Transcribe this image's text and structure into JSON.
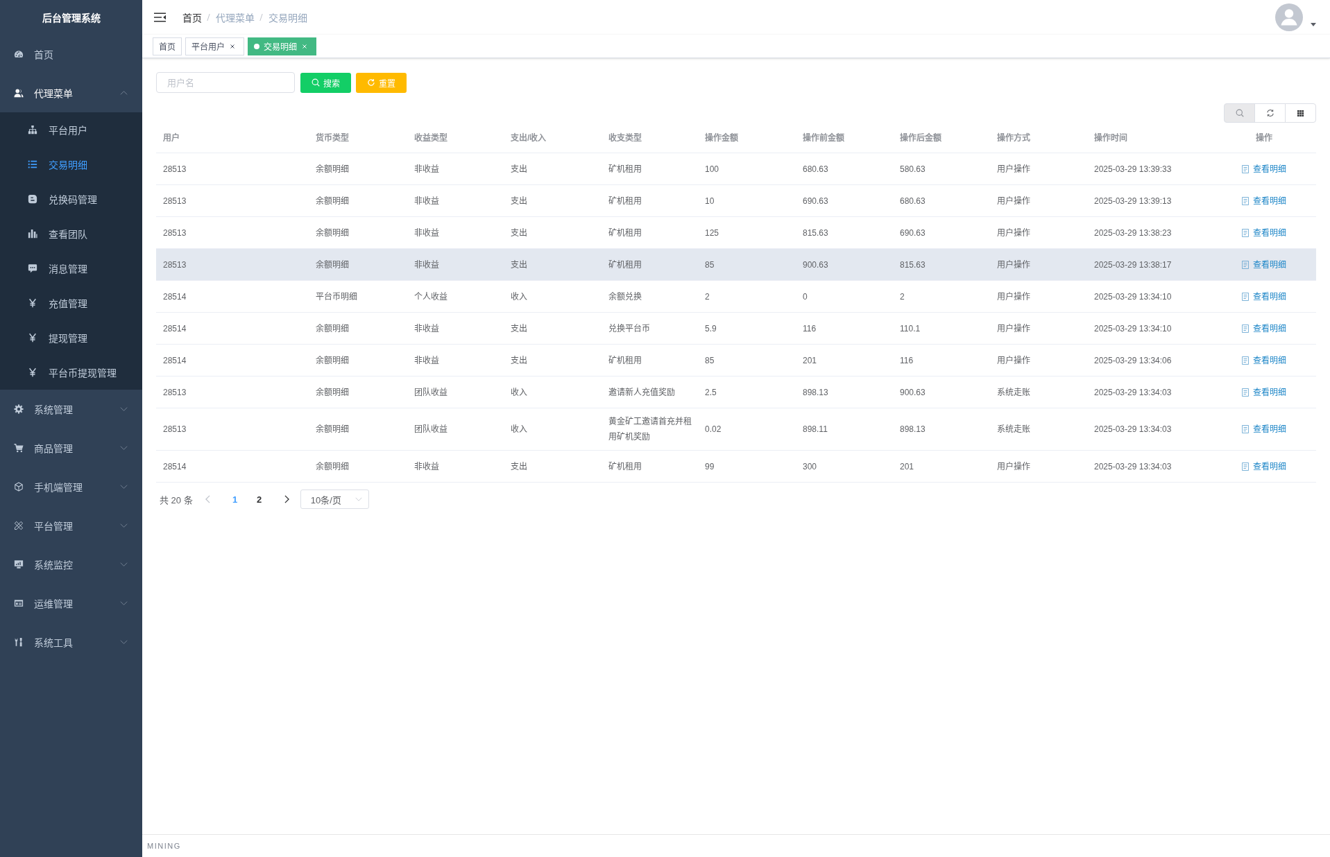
{
  "sidebar": {
    "title": "后台管理系统",
    "items": [
      {
        "kind": "link",
        "label": "首页",
        "selected": false
      },
      {
        "kind": "submenu",
        "label": "代理菜单",
        "expanded": true,
        "children": [
          {
            "label": "平台用户",
            "selected": false
          },
          {
            "label": "交易明细",
            "selected": true
          },
          {
            "label": "兑换码管理",
            "selected": false
          },
          {
            "label": "查看团队",
            "selected": false
          },
          {
            "label": "消息管理",
            "selected": false
          },
          {
            "label": "充值管理",
            "selected": false
          },
          {
            "label": "提现管理",
            "selected": false
          },
          {
            "label": "平台币提现管理",
            "selected": false
          }
        ]
      },
      {
        "kind": "submenu",
        "label": "系统管理",
        "expanded": false
      },
      {
        "kind": "submenu",
        "label": "商品管理",
        "expanded": false
      },
      {
        "kind": "submenu",
        "label": "手机端管理",
        "expanded": false
      },
      {
        "kind": "submenu",
        "label": "平台管理",
        "expanded": false
      },
      {
        "kind": "submenu",
        "label": "系统监控",
        "expanded": false
      },
      {
        "kind": "submenu",
        "label": "运维管理",
        "expanded": false
      },
      {
        "kind": "submenu",
        "label": "系统工具",
        "expanded": false
      }
    ]
  },
  "breadcrumb": [
    {
      "label": "首页",
      "link": true
    },
    {
      "label": "代理菜单",
      "link": false
    },
    {
      "label": "交易明细",
      "link": false
    }
  ],
  "tags": [
    {
      "label": "首页",
      "selected": false,
      "closable": false
    },
    {
      "label": "平台用户",
      "selected": false,
      "closable": true
    },
    {
      "label": "交易明细",
      "selected": true,
      "closable": true
    }
  ],
  "search": {
    "placeholder": "用户名",
    "buttons": [
      {
        "kind": "success",
        "label": "搜索"
      },
      {
        "kind": "warning",
        "label": "重置"
      }
    ]
  },
  "toolbar": [
    {
      "selected": true
    },
    {
      "selected": false
    },
    {
      "selected": false
    }
  ],
  "table": {
    "columns": [
      "用户",
      "货币类型",
      "收益类型",
      "支出/收入",
      "收支类型",
      "操作金额",
      "操作前金额",
      "操作后金额",
      "操作方式",
      "操作时间",
      "操作"
    ],
    "rows": [
      {
        "cells": [
          "28513",
          "余额明细",
          "非收益",
          "支出",
          "矿机租用",
          "100",
          "680.63",
          "580.63",
          "用户操作",
          "2025-03-29 13:39:33"
        ],
        "action": "查看明细",
        "highlighted": false
      },
      {
        "cells": [
          "28513",
          "余额明细",
          "非收益",
          "支出",
          "矿机租用",
          "10",
          "690.63",
          "680.63",
          "用户操作",
          "2025-03-29 13:39:13"
        ],
        "action": "查看明细",
        "highlighted": false
      },
      {
        "cells": [
          "28513",
          "余额明细",
          "非收益",
          "支出",
          "矿机租用",
          "125",
          "815.63",
          "690.63",
          "用户操作",
          "2025-03-29 13:38:23"
        ],
        "action": "查看明细",
        "highlighted": false
      },
      {
        "cells": [
          "28513",
          "余额明细",
          "非收益",
          "支出",
          "矿机租用",
          "85",
          "900.63",
          "815.63",
          "用户操作",
          "2025-03-29 13:38:17"
        ],
        "action": "查看明细",
        "highlighted": true
      },
      {
        "cells": [
          "28514",
          "平台币明细",
          "个人收益",
          "收入",
          "余额兑换",
          "2",
          "0",
          "2",
          "用户操作",
          "2025-03-29 13:34:10"
        ],
        "action": "查看明细",
        "highlighted": false
      },
      {
        "cells": [
          "28514",
          "余额明细",
          "非收益",
          "支出",
          "兑换平台币",
          "5.9",
          "116",
          "110.1",
          "用户操作",
          "2025-03-29 13:34:10"
        ],
        "action": "查看明细",
        "highlighted": false
      },
      {
        "cells": [
          "28514",
          "余额明细",
          "非收益",
          "支出",
          "矿机租用",
          "85",
          "201",
          "116",
          "用户操作",
          "2025-03-29 13:34:06"
        ],
        "action": "查看明细",
        "highlighted": false
      },
      {
        "cells": [
          "28513",
          "余额明细",
          "团队收益",
          "收入",
          "邀请新人充值奖励",
          "2.5",
          "898.13",
          "900.63",
          "系统走账",
          "2025-03-29 13:34:03"
        ],
        "action": "查看明细",
        "highlighted": false
      },
      {
        "cells": [
          "28513",
          "余额明细",
          "团队收益",
          "收入",
          "黄金矿工邀请首充并租用矿机奖励",
          "0.02",
          "898.11",
          "898.13",
          "系统走账",
          "2025-03-29 13:34:03"
        ],
        "action": "查看明细",
        "highlighted": false
      },
      {
        "cells": [
          "28514",
          "余额明细",
          "非收益",
          "支出",
          "矿机租用",
          "99",
          "300",
          "201",
          "用户操作",
          "2025-03-29 13:34:03"
        ],
        "action": "查看明细",
        "highlighted": false
      }
    ]
  },
  "pagination": {
    "total": "共 20 条",
    "previous": {
      "disabled": true
    },
    "pages": [
      {
        "label": "1",
        "selected": true
      },
      {
        "label": "2",
        "selected": false
      }
    ],
    "next": {
      "disabled": false
    },
    "page_size": "10条/页"
  },
  "footer": {
    "text": "MINING"
  }
}
